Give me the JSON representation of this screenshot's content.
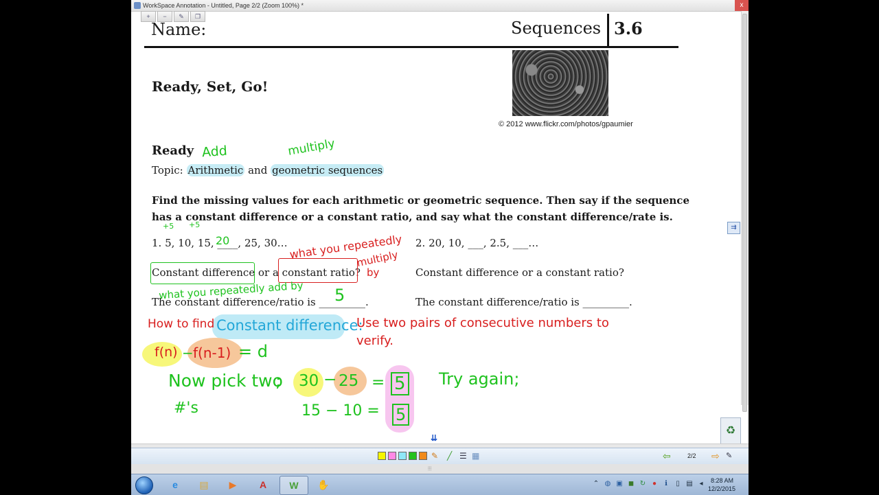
{
  "window": {
    "title": "WorkSpace Annotation - Untitled, Page 2/2  (Zoom 100%) *",
    "close_label": "x"
  },
  "quick_tools": [
    {
      "icon": "plus-icon",
      "glyph": "+"
    },
    {
      "icon": "minus-icon",
      "glyph": "−"
    },
    {
      "icon": "edit-page-icon",
      "glyph": "✎"
    },
    {
      "icon": "copy-page-icon",
      "glyph": "❐"
    }
  ],
  "document": {
    "name_label": "Name:",
    "sequences_label": "Sequences",
    "section_number": "3.6",
    "photo_credit": "© 2012 www.flickr.com/photos/gpaumier",
    "title": "Ready, Set, Go!",
    "ready_heading": "Ready",
    "topic_prefix": "Topic: ",
    "topic_arith": "Arithmetic",
    "topic_and": " and ",
    "topic_geo": "geometric sequences",
    "instructions_line1": "Find the missing values for each arithmetic or geometric sequence. Then say if the sequence",
    "instructions_line2": "has a constant difference or a constant ratio, and say what the constant difference/rate is.",
    "problem1": "1.  5, 10, 15, ____, 25, 30…",
    "problem2": "2.   20, 10, ___, 2.5, ___…",
    "cd_text": "Constant difference",
    "or_a_text": " or a ",
    "cr_text": "constant ratio?",
    "question2": "Constant difference or a constant ratio?",
    "cdr1": "The constant difference/ratio is _________.",
    "cdr2": "The constant difference/ratio is _________."
  },
  "annotations": {
    "add": "Add",
    "multiply": "multiply",
    "plus5_a": "+5",
    "plus5_b": "+5",
    "blank_20": "20",
    "what_repeatedly": "what you repeatedly",
    "multiply_by": "multiply",
    "by": "by",
    "what_add_by": "what you repeatedly add by",
    "five_answer": "5",
    "how_to_find": "How to find",
    "constant_difference": "Constant difference:",
    "use_two_pairs": "Use two pairs of consecutive numbers to",
    "verify": "verify.",
    "fn": "f(n)",
    "minus": "−",
    "fn1": "f(n-1)",
    "equals_d": "= d",
    "now_pick": "Now pick two",
    "semicolon": ";",
    "hash_s": "#'s",
    "thirty": "30",
    "dash": "−",
    "twenty_five": "25",
    "eq": "=",
    "five_box1": "5",
    "try_again": "Try again;",
    "fifteen_minus_ten": "15 − 10 =",
    "five_box2": "5"
  },
  "toolbar": {
    "swatch_colors": [
      "#f5f500",
      "#ff88e6",
      "#8fe7f7",
      "#25c11e",
      "#f08a1c"
    ],
    "page_indicator": "2/2",
    "prev_icon": "arrow-left-icon",
    "next_icon": "arrow-right-icon"
  },
  "taskbar": {
    "apps": [
      {
        "name": "internet-explorer",
        "glyph": "e",
        "color": "#2a8be0"
      },
      {
        "name": "file-explorer",
        "glyph": "▤",
        "color": "#e8c25a"
      },
      {
        "name": "media-player",
        "glyph": "▶",
        "color": "#e8792a"
      },
      {
        "name": "acrobat",
        "glyph": "A",
        "color": "#c9302c"
      },
      {
        "name": "workspace",
        "glyph": "W",
        "color": "#4aa03a"
      },
      {
        "name": "app-six",
        "glyph": "✋",
        "color": "#6f4e2d"
      }
    ],
    "time": "8:28 AM",
    "date": "12/2/2015"
  }
}
